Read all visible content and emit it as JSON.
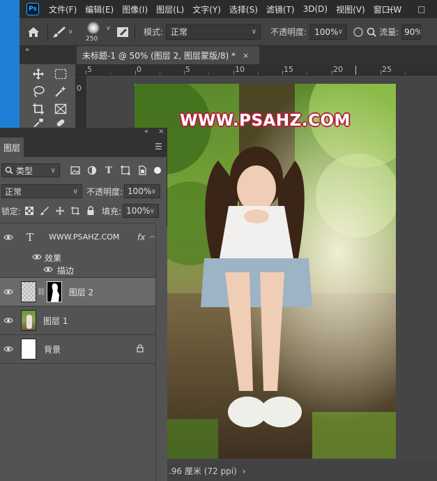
{
  "app": {
    "logo_text": "Ps",
    "accent": "#31a8ff"
  },
  "menu": [
    "文件(F)",
    "编辑(E)",
    "图像(I)",
    "图层(L)",
    "文字(Y)",
    "选择(S)",
    "滤镜(T)",
    "3D(D)",
    "视图(V)",
    "窗口(W"
  ],
  "window_controls": {
    "minimize": "—",
    "maximize": "□"
  },
  "options": {
    "brush_size": "250",
    "mode_label": "模式:",
    "mode_value": "正常",
    "opacity_label": "不透明度:",
    "opacity_value": "100%",
    "flow_label": "流量:",
    "flow_value": "90%"
  },
  "document_tab": {
    "title": "未标题-1 @ 50% (图层 2, 图层蒙版/8) *",
    "close": "×",
    "collapse": "«"
  },
  "ruler": {
    "h_labels": [
      "5",
      "0",
      "5",
      "10",
      "15",
      "20",
      "25"
    ],
    "v_labels": [
      "0"
    ]
  },
  "canvas": {
    "watermark": "WWW.PSAHZ.COM"
  },
  "status": {
    "text": ".96 厘米 (72 ppi)",
    "arrow": "›"
  },
  "layers_panel": {
    "tab_label": "图层",
    "collapse": "«",
    "close": "×",
    "filter_label": "类型",
    "blend_mode": "正常",
    "opacity_label": "不透明度:",
    "opacity_value": "100%",
    "lock_label": "锁定:",
    "fill_label": "填充:",
    "fill_value": "100%",
    "layers": [
      {
        "name": "WWW.PSAHZ.COM",
        "fx": "fx"
      },
      {
        "name": "效果"
      },
      {
        "name": "描边"
      },
      {
        "name": "图层 2"
      },
      {
        "name": "图层 1"
      },
      {
        "name": "背景"
      }
    ]
  }
}
